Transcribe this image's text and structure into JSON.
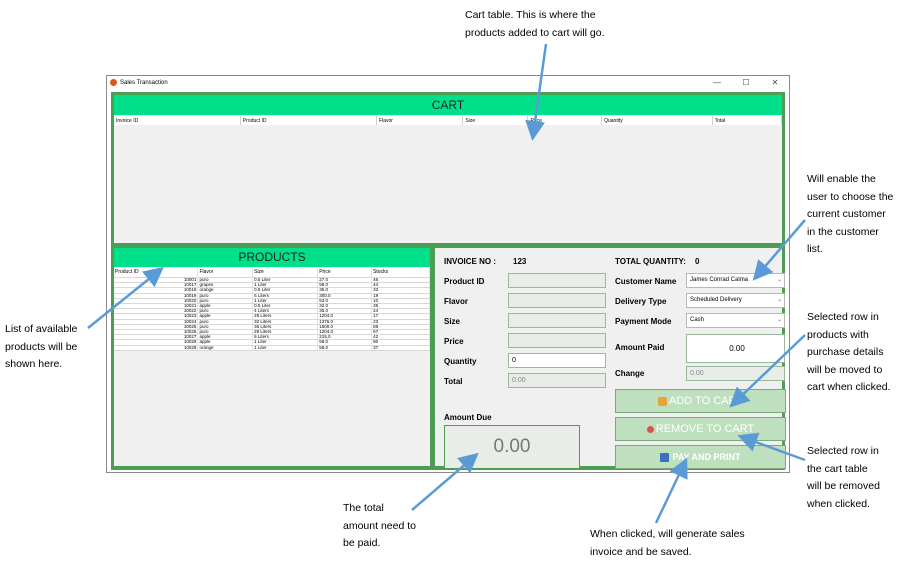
{
  "window": {
    "title": "Sales Transaction",
    "minimize": "—",
    "maximize": "☐",
    "close": "✕"
  },
  "cart": {
    "title": "CART",
    "columns": [
      "Invoice ID",
      "Product ID",
      "Flavor",
      "Size",
      "Price",
      "Quantity",
      "Total"
    ]
  },
  "products": {
    "title": "PRODUCTS",
    "columns": [
      "Product ID",
      "Flavor",
      "Size",
      "Price",
      "Stocks"
    ],
    "rows": [
      [
        "10001",
        "puro",
        "0.5 Liter",
        "27.0",
        "46"
      ],
      [
        "10017",
        "grapes",
        "1 Liter",
        "58.0",
        "44"
      ],
      [
        "10018",
        "orange",
        "0.5 Liter",
        "35.0",
        "33"
      ],
      [
        "10019",
        "puro",
        "6 Liters",
        "300.0",
        "19"
      ],
      [
        "10020",
        "puro",
        "1 Liter",
        "53.0",
        "10"
      ],
      [
        "10021",
        "apple",
        "0.5 Liter",
        "32.0",
        "35"
      ],
      [
        "10022",
        "puro",
        "4 Liters",
        "35.0",
        "44"
      ],
      [
        "10023",
        "apple",
        "28 Liters",
        "1204.0",
        "17"
      ],
      [
        "10024",
        "puro",
        "32 Liters",
        "1376.0",
        "23"
      ],
      [
        "10025",
        "puro",
        "36 Liters",
        "1500.0",
        "89"
      ],
      [
        "10026",
        "puro",
        "28 Liters",
        "1204.0",
        "67"
      ],
      [
        "10027",
        "apple",
        "6 Liters",
        "215.0",
        "42"
      ],
      [
        "10028",
        "apple",
        "1 Liter",
        "58.0",
        "80"
      ],
      [
        "10029",
        "orange",
        "1 Liter",
        "58.0",
        "37"
      ]
    ]
  },
  "form": {
    "invoice_label": "INVOICE NO :",
    "invoice_value": "123",
    "product_id_label": "Product ID",
    "flavor_label": "Flavor",
    "size_label": "Size",
    "price_label": "Price",
    "quantity_label": "Quantity",
    "quantity_value": "0",
    "total_label": "Total",
    "total_value": "0.00",
    "amount_due_label": "Amount Due",
    "amount_due_value": "0.00"
  },
  "side": {
    "total_quantity_label": "TOTAL QUANTITY:",
    "total_quantity_value": "0",
    "customer_label": "Customer Name",
    "customer_value": "James Conrad Calma",
    "delivery_label": "Delivery Type",
    "delivery_value": "Scheduled Delivery",
    "payment_label": "Payment Mode",
    "payment_value": "Cash",
    "amount_paid_label": "Amount Paid",
    "amount_paid_value": "0.00",
    "change_label": "Change",
    "change_value": "0.00",
    "add_to_cart": "ADD TO CART",
    "remove_from_cart": "REMOVE TO CART",
    "pay_and_print": "PAY AND PRINT"
  },
  "annotations": {
    "cart_table": [
      "Cart table. This is where the",
      "products added to cart will go."
    ],
    "products_list": [
      "List of available",
      "products will be",
      "shown here."
    ],
    "customer": [
      "Will enable the",
      "user to choose the",
      "current customer",
      "in the customer",
      "list."
    ],
    "add_row": [
      "Selected row in",
      "products with",
      "purchase details",
      "will be moved to",
      "cart when clicked."
    ],
    "remove_row": [
      "Selected row in",
      "the cart table",
      "will be removed",
      "when clicked."
    ],
    "amount": [
      "The total",
      "amount need to",
      "be paid."
    ],
    "pay": [
      "When clicked, will generate sales",
      "invoice and be saved."
    ]
  },
  "colors": {
    "header_green": "#00e08a",
    "border_green": "#4d9e55",
    "button_green": "#bfe0bf",
    "arrow_blue": "#5b9bd5"
  }
}
